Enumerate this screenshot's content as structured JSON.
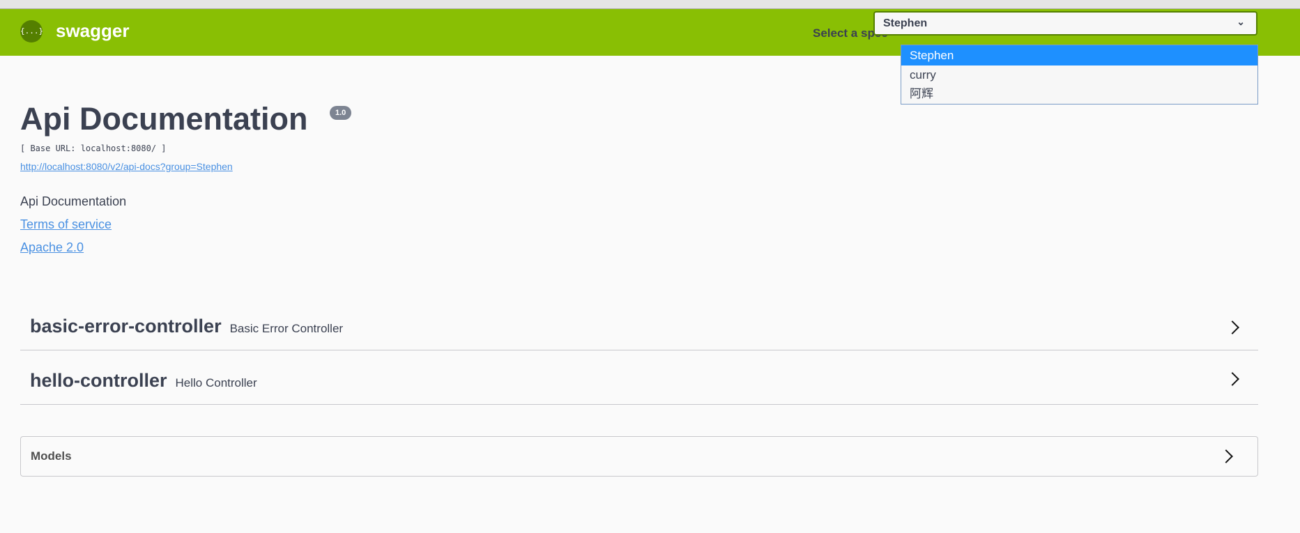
{
  "header": {
    "brand": "swagger",
    "logo_glyph": "{...}",
    "spec_label": "Select a spec",
    "selected_spec": "Stephen",
    "spec_options": [
      "Stephen",
      "curry",
      "阿辉"
    ],
    "color": "#89bf04"
  },
  "info": {
    "title": "Api Documentation",
    "version": "1.0",
    "base_url": "[ Base URL: localhost:8080/ ]",
    "spec_url": "http://localhost:8080/v2/api-docs?group=Stephen",
    "description": "Api Documentation",
    "terms": "Terms of service",
    "license": "Apache 2.0"
  },
  "tags": [
    {
      "name": "basic-error-controller",
      "description": "Basic Error Controller"
    },
    {
      "name": "hello-controller",
      "description": "Hello Controller"
    }
  ],
  "models": {
    "title": "Models"
  }
}
